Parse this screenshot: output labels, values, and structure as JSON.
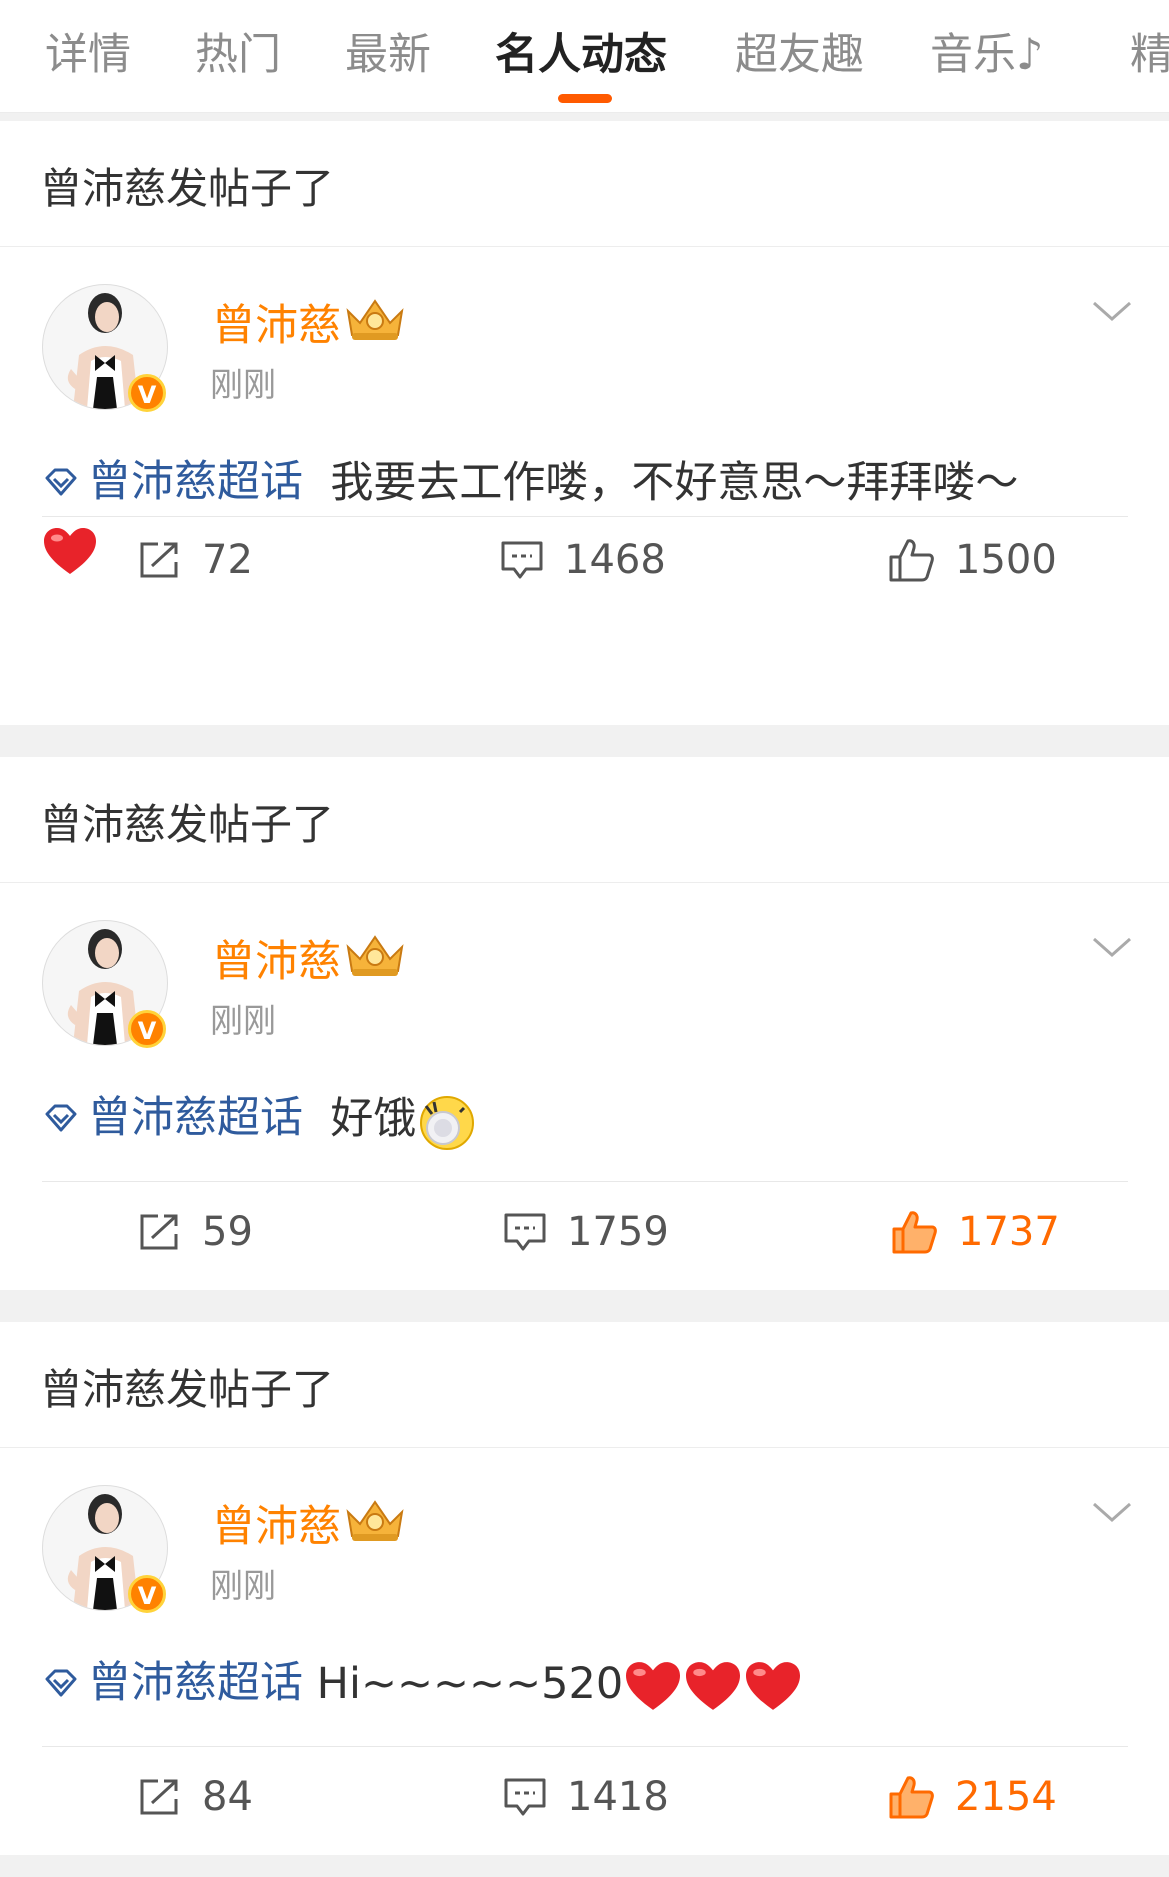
{
  "tabs": [
    "详情",
    "热门",
    "最新",
    "名人动态",
    "超友趣",
    "音乐♪",
    "精"
  ],
  "active_tab": "名人动态",
  "posts": [
    {
      "header": "曾沛慈发帖子了",
      "author": "曾沛慈",
      "time": "刚刚",
      "topic": "曾沛慈超话",
      "text": "我要去工作喽，不好意思～拜拜喽～",
      "emojis": [
        "heart"
      ],
      "repost": "72",
      "comments": "1468",
      "likes": "1500",
      "liked": false
    },
    {
      "header": "曾沛慈发帖子了",
      "author": "曾沛慈",
      "time": "刚刚",
      "topic": "曾沛慈超话",
      "text": "好饿",
      "emojis": [
        "hungry-face"
      ],
      "repost": "59",
      "comments": "1759",
      "likes": "1737",
      "liked": true
    },
    {
      "header": "曾沛慈发帖子了",
      "author": "曾沛慈",
      "time": "刚刚",
      "topic": "曾沛慈超话",
      "text": "Hi~~~~~520",
      "emojis": [
        "heart",
        "heart",
        "heart"
      ],
      "repost": "84",
      "comments": "1418",
      "likes": "2154",
      "liked": true
    }
  ],
  "colors": {
    "accent": "#ff8200",
    "link": "#2f5b9d",
    "liked": "#ff6a00",
    "heart": "#e8232a"
  },
  "icons": [
    "repost-icon",
    "comment-icon",
    "like-icon",
    "diamond-topic-icon",
    "crown-icon",
    "chevron-down-icon",
    "verified-badge-icon"
  ]
}
